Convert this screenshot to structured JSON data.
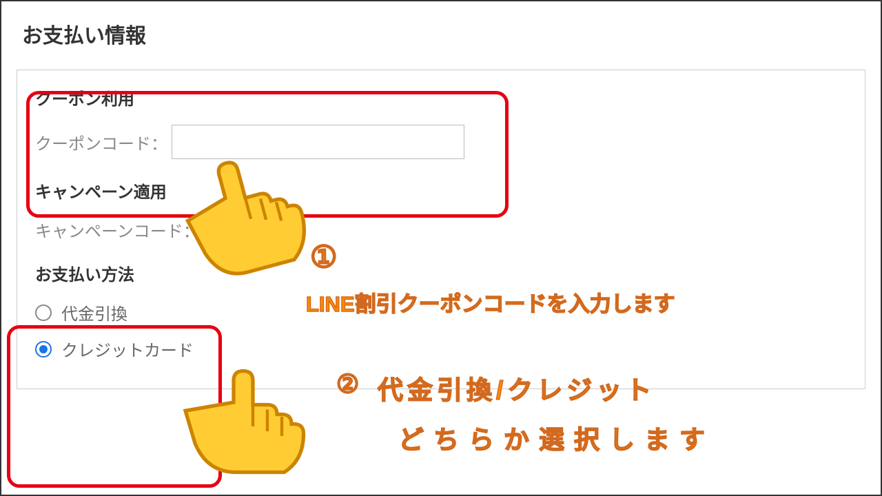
{
  "header": {
    "title": "お支払い情報"
  },
  "coupon": {
    "section_label": "クーポン利用",
    "field_label": "クーポンコード："
  },
  "campaign": {
    "section_label": "キャンペーン適用",
    "field_label": "キャンペーンコード："
  },
  "payment_method": {
    "section_label": "お支払い方法",
    "options": [
      {
        "label": "代金引換",
        "selected": false
      },
      {
        "label": "クレジットカード",
        "selected": true
      }
    ]
  },
  "annotations": {
    "num1": "①",
    "line1": "LINE割引クーポンコードを入力します",
    "num2": "②",
    "line2a": "代金引換/クレジット",
    "line2b": "どちらか選択します"
  },
  "colors": {
    "highlight": "#e60012",
    "annotation_text": "#ff8c00",
    "radio_selected": "#1a73e8"
  }
}
